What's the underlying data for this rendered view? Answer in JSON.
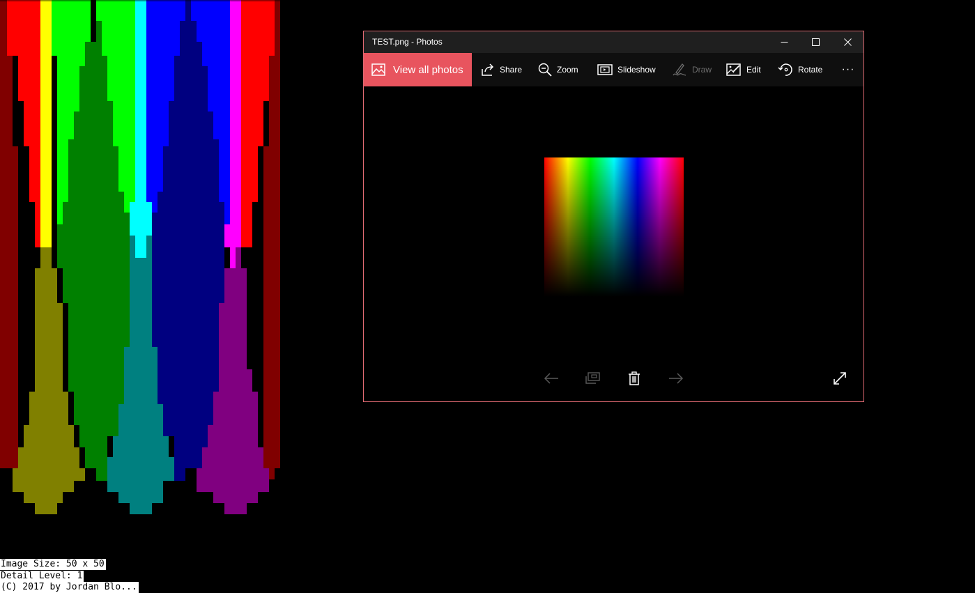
{
  "console": {
    "line1": "Image Size: 50 x 50",
    "line2": "Detail Level: 1",
    "line3": "(C) 2017 by Jordan Blo..."
  },
  "window": {
    "title": "TEST.png - Photos",
    "border_color": "#e06a72"
  },
  "toolbar": {
    "view_all_label": "View all photos",
    "accent_color": "#e8545e",
    "items": [
      {
        "label": "Share",
        "icon": "share-icon"
      },
      {
        "label": "Zoom",
        "icon": "zoom-icon"
      },
      {
        "label": "Slideshow",
        "icon": "slideshow-icon"
      },
      {
        "label": "Draw",
        "icon": "draw-icon",
        "disabled": true
      },
      {
        "label": "Edit",
        "icon": "edit-icon"
      },
      {
        "label": "Rotate",
        "icon": "rotate-icon"
      }
    ],
    "more_label": "···"
  },
  "viewer": {
    "image_description_colors": [
      "#ff0000",
      "#ffff00",
      "#00ff00",
      "#00ffff",
      "#0000ff",
      "#ff00ff",
      "#ff0000"
    ]
  }
}
